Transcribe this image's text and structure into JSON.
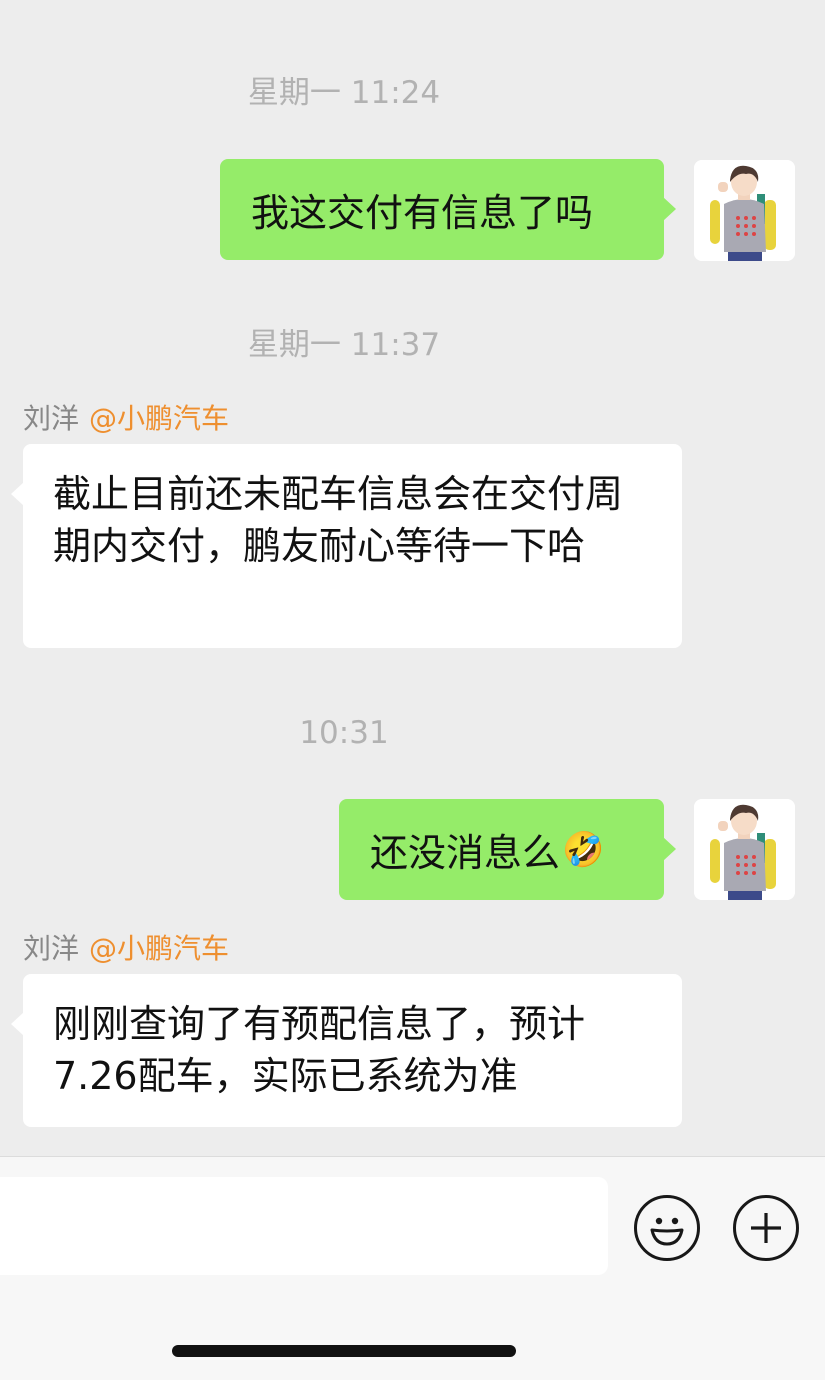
{
  "messages": [
    {
      "time": "星期一 11:24"
    },
    {
      "text": "我这交付有信息了吗"
    },
    {
      "time": "星期一 11:37"
    },
    {
      "sender": "刘洋",
      "mention": "@小鹏汽车",
      "text": "截止目前还未配车信息会在交付周期内交付，鹏友耐心等待一下哈"
    },
    {
      "time": "10:31"
    },
    {
      "text": "还没消息么",
      "emoji": "🤣"
    },
    {
      "sender": "刘洋",
      "mention": "@小鹏汽车",
      "text": "刚刚查询了有预配信息了，预计7.26配车，实际已系统为准"
    }
  ],
  "input": {
    "placeholder": "",
    "emoji_button_icon": "smiley-icon",
    "more_button_icon": "plus-icon"
  },
  "colors": {
    "background": "#ededed",
    "my_bubble": "#95ec69",
    "their_bubble": "#ffffff",
    "timestamp": "#b2b2b2",
    "sender": "#888888",
    "mention": "#ee8f2f"
  }
}
